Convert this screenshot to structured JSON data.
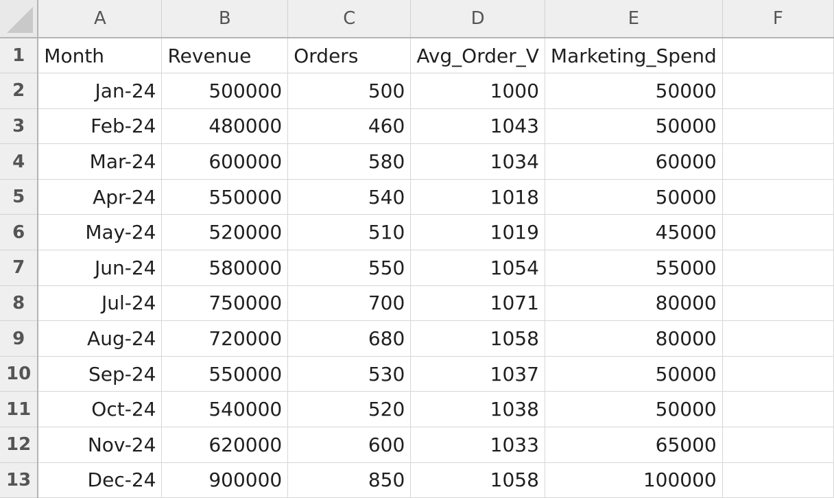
{
  "columns": [
    "A",
    "B",
    "C",
    "D",
    "E",
    "F"
  ],
  "rows": [
    "1",
    "2",
    "3",
    "4",
    "5",
    "6",
    "7",
    "8",
    "9",
    "10",
    "11",
    "12",
    "13"
  ],
  "header_row": [
    "Month",
    "Revenue",
    "Orders",
    "Avg_Order_V",
    "Marketing_Spend",
    ""
  ],
  "data": [
    [
      "Jan-24",
      "500000",
      "500",
      "1000",
      "50000"
    ],
    [
      "Feb-24",
      "480000",
      "460",
      "1043",
      "50000"
    ],
    [
      "Mar-24",
      "600000",
      "580",
      "1034",
      "60000"
    ],
    [
      "Apr-24",
      "550000",
      "540",
      "1018",
      "50000"
    ],
    [
      "May-24",
      "520000",
      "510",
      "1019",
      "45000"
    ],
    [
      "Jun-24",
      "580000",
      "550",
      "1054",
      "55000"
    ],
    [
      "Jul-24",
      "750000",
      "700",
      "1071",
      "80000"
    ],
    [
      "Aug-24",
      "720000",
      "680",
      "1058",
      "80000"
    ],
    [
      "Sep-24",
      "550000",
      "530",
      "1037",
      "50000"
    ],
    [
      "Oct-24",
      "540000",
      "520",
      "1038",
      "50000"
    ],
    [
      "Nov-24",
      "620000",
      "600",
      "1033",
      "65000"
    ],
    [
      "Dec-24",
      "900000",
      "850",
      "1058",
      "100000"
    ]
  ]
}
